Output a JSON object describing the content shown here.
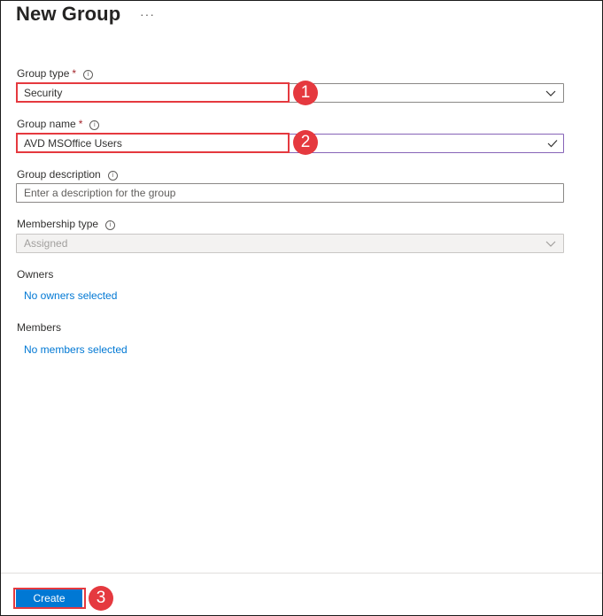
{
  "header": {
    "title": "New Group",
    "more_label": "···"
  },
  "form": {
    "group_type": {
      "label": "Group type",
      "required_mark": "*",
      "value": "Security"
    },
    "group_name": {
      "label": "Group name",
      "required_mark": "*",
      "value": "AVD MSOffice Users"
    },
    "group_description": {
      "label": "Group description",
      "placeholder": "Enter a description for the group"
    },
    "membership_type": {
      "label": "Membership type",
      "value": "Assigned",
      "disabled": true
    },
    "owners": {
      "label": "Owners",
      "link": "No owners selected"
    },
    "members": {
      "label": "Members",
      "link": "No members selected"
    },
    "info_icon": "i"
  },
  "footer": {
    "create_label": "Create"
  },
  "annotations": {
    "step1": "1",
    "step2": "2",
    "step3": "3",
    "highlight_color": "#e5393f"
  },
  "colors": {
    "accent": "#0078d4",
    "focus_border": "#8764b8",
    "required": "#a4262c"
  }
}
